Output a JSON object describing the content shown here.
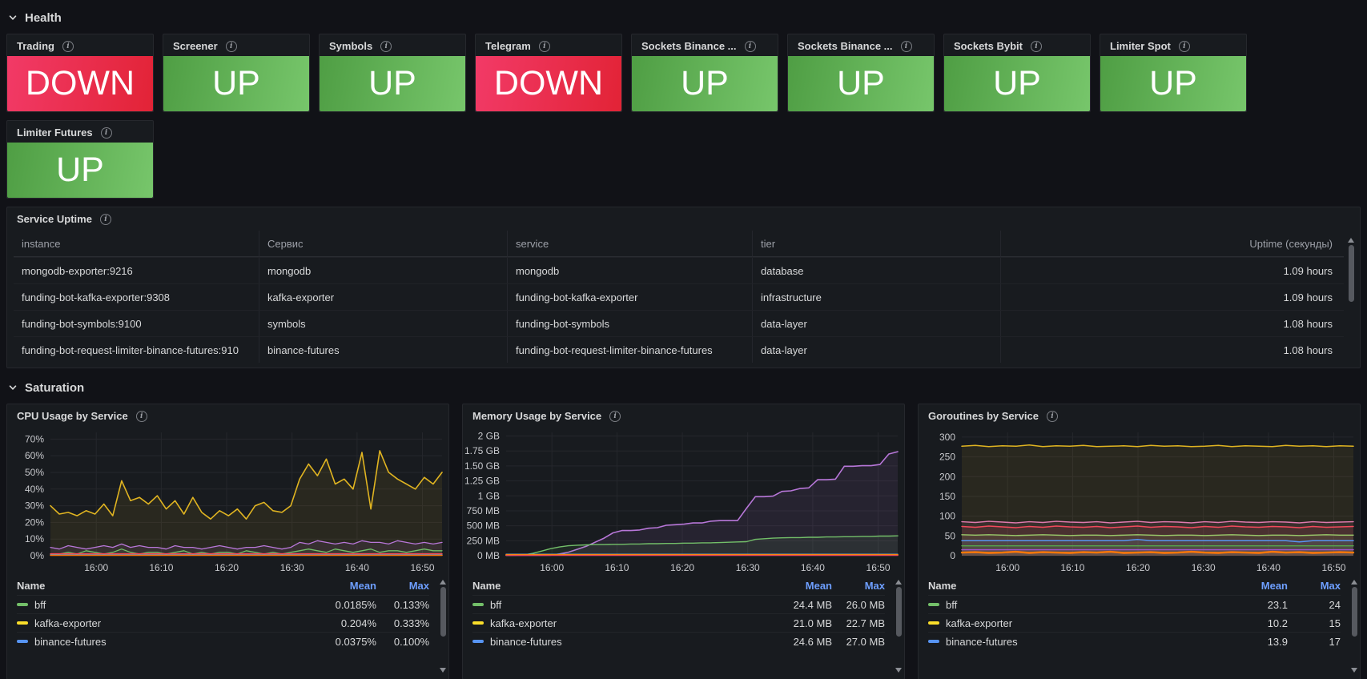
{
  "sections": {
    "health": {
      "label": "Health"
    },
    "saturation": {
      "label": "Saturation"
    }
  },
  "icons": {
    "info": "i"
  },
  "status_colors": {
    "up_gradient": [
      "#4f9e44",
      "#77c66b"
    ],
    "down_gradient": [
      "#f23a67",
      "#e22336"
    ]
  },
  "status_panels": [
    {
      "title": "Trading",
      "state": "DOWN"
    },
    {
      "title": "Screener",
      "state": "UP"
    },
    {
      "title": "Symbols",
      "state": "UP"
    },
    {
      "title": "Telegram",
      "state": "DOWN"
    },
    {
      "title": "Sockets Binance ...",
      "state": "UP"
    },
    {
      "title": "Sockets Binance ...",
      "state": "UP"
    },
    {
      "title": "Sockets Bybit",
      "state": "UP"
    },
    {
      "title": "Limiter Spot",
      "state": "UP"
    },
    {
      "title": "Limiter Futures",
      "state": "UP"
    }
  ],
  "uptime_table": {
    "title": "Service Uptime",
    "columns": [
      "instance",
      "Сервис",
      "service",
      "tier",
      "Uptime (секунды)"
    ],
    "rows": [
      [
        "mongodb-exporter:9216",
        "mongodb",
        "mongodb",
        "database",
        "1.09 hours"
      ],
      [
        "funding-bot-kafka-exporter:9308",
        "kafka-exporter",
        "funding-bot-kafka-exporter",
        "infrastructure",
        "1.09 hours"
      ],
      [
        "funding-bot-symbols:9100",
        "symbols",
        "funding-bot-symbols",
        "data-layer",
        "1.08 hours"
      ],
      [
        "funding-bot-request-limiter-binance-futures:910",
        "binance-futures",
        "funding-bot-request-limiter-binance-futures",
        "data-layer",
        "1.08 hours"
      ]
    ]
  },
  "chart_data": [
    {
      "id": "cpu",
      "type": "area",
      "title": "CPU Usage by Service",
      "xlabel": "",
      "ylabel": "",
      "ylim": [
        0,
        74
      ],
      "yticks": [
        {
          "label": "0%",
          "v": 0
        },
        {
          "label": "10%",
          "v": 10
        },
        {
          "label": "20%",
          "v": 20
        },
        {
          "label": "30%",
          "v": 30
        },
        {
          "label": "40%",
          "v": 40
        },
        {
          "label": "50%",
          "v": 50
        },
        {
          "label": "60%",
          "v": 60
        },
        {
          "label": "70%",
          "v": 70
        }
      ],
      "xticks": [
        {
          "label": "16:00",
          "f": 0.117
        },
        {
          "label": "16:10",
          "f": 0.283
        },
        {
          "label": "16:20",
          "f": 0.45
        },
        {
          "label": "16:30",
          "f": 0.617
        },
        {
          "label": "16:40",
          "f": 0.783
        },
        {
          "label": "16:50",
          "f": 0.95
        }
      ],
      "series": [
        {
          "name": "series-yellow",
          "color": "#e0b421",
          "width": 1.6,
          "values": [
            30,
            25,
            26,
            24,
            27,
            25,
            31,
            24,
            45,
            33,
            35,
            31,
            36,
            28,
            33,
            25,
            35,
            26,
            22,
            27,
            24,
            28,
            22,
            30,
            32,
            27,
            26,
            30,
            46,
            55,
            48,
            58,
            43,
            46,
            40,
            62,
            28,
            63,
            50,
            46,
            43,
            40,
            47,
            43,
            50
          ]
        },
        {
          "name": "series-purple",
          "color": "#b877d9",
          "width": 1.3,
          "values": [
            5,
            4,
            6,
            5,
            4,
            5,
            6,
            5,
            7,
            5,
            6,
            5,
            5,
            4,
            6,
            5,
            5,
            4,
            5,
            6,
            5,
            4,
            5,
            5,
            6,
            5,
            4,
            5,
            8,
            7,
            9,
            8,
            7,
            8,
            7,
            9,
            8,
            8,
            7,
            9,
            8,
            7,
            8,
            7,
            8
          ]
        },
        {
          "name": "series-green",
          "color": "#73bf69",
          "width": 1.3,
          "values": [
            1,
            1,
            2,
            1,
            3,
            2,
            1,
            2,
            4,
            2,
            1,
            2,
            2,
            1,
            2,
            3,
            1,
            2,
            1,
            2,
            2,
            1,
            3,
            2,
            1,
            2,
            1,
            2,
            3,
            4,
            3,
            2,
            4,
            3,
            2,
            3,
            4,
            2,
            3,
            3,
            2,
            3,
            4,
            3,
            3
          ]
        },
        {
          "name": "series-red",
          "color": "#f2495c",
          "width": 1.3,
          "values": [
            1.2,
            1.2
          ]
        },
        {
          "name": "series-blue",
          "color": "#5794f2",
          "width": 1.3,
          "values": [
            0.6,
            0.6
          ]
        },
        {
          "name": "series-orange",
          "color": "#ff780a",
          "width": 1.6,
          "values": [
            0.3,
            0.3
          ]
        }
      ],
      "legend": {
        "columns": [
          "Name",
          "Mean",
          "Max"
        ],
        "rows": [
          {
            "name": "bff",
            "color": "#73bf69",
            "mean": "0.0185%",
            "max": "0.133%"
          },
          {
            "name": "kafka-exporter",
            "color": "#fade2a",
            "mean": "0.204%",
            "max": "0.333%"
          },
          {
            "name": "binance-futures",
            "color": "#5794f2",
            "mean": "0.0375%",
            "max": "0.100%"
          }
        ]
      }
    },
    {
      "id": "memory",
      "type": "area",
      "title": "Memory Usage by Service",
      "xlabel": "",
      "ylabel": "",
      "ylim": [
        0,
        2110
      ],
      "yticks": [
        {
          "label": "0 MB",
          "v": 0
        },
        {
          "label": "250 MB",
          "v": 256
        },
        {
          "label": "500 MB",
          "v": 512
        },
        {
          "label": "750 MB",
          "v": 768
        },
        {
          "label": "1 GB",
          "v": 1024
        },
        {
          "label": "1.25 GB",
          "v": 1280
        },
        {
          "label": "1.50 GB",
          "v": 1536
        },
        {
          "label": "1.75 GB",
          "v": 1792
        },
        {
          "label": "2 GB",
          "v": 2048
        }
      ],
      "xticks": [
        {
          "label": "16:00",
          "f": 0.117
        },
        {
          "label": "16:10",
          "f": 0.283
        },
        {
          "label": "16:20",
          "f": 0.45
        },
        {
          "label": "16:30",
          "f": 0.617
        },
        {
          "label": "16:40",
          "f": 0.783
        },
        {
          "label": "16:50",
          "f": 0.95
        }
      ],
      "series": [
        {
          "name": "series-purple",
          "color": "#b877d9",
          "width": 1.6,
          "values": [
            8,
            8,
            8,
            8,
            8,
            10,
            30,
            60,
            110,
            160,
            230,
            300,
            390,
            430,
            430,
            440,
            470,
            480,
            520,
            530,
            540,
            560,
            560,
            590,
            600,
            600,
            600,
            810,
            1010,
            1010,
            1020,
            1100,
            1110,
            1150,
            1160,
            1300,
            1300,
            1310,
            1530,
            1530,
            1540,
            1540,
            1560,
            1740,
            1780
          ]
        },
        {
          "name": "series-green",
          "color": "#73bf69",
          "width": 1.4,
          "values": [
            5,
            8,
            15,
            40,
            80,
            120,
            150,
            170,
            180,
            185,
            190,
            190,
            195,
            195,
            200,
            200,
            205,
            205,
            210,
            210,
            215,
            215,
            220,
            220,
            225,
            230,
            235,
            240,
            280,
            290,
            300,
            305,
            310,
            310,
            315,
            315,
            320,
            320,
            325,
            325,
            330,
            330,
            335,
            335,
            340
          ]
        },
        {
          "name": "series-blue",
          "color": "#5794f2",
          "width": 1.3,
          "values": [
            25,
            25
          ]
        },
        {
          "name": "series-yellow",
          "color": "#e0b421",
          "width": 1.3,
          "values": [
            21,
            21
          ]
        },
        {
          "name": "series-orange",
          "color": "#ff780a",
          "width": 1.8,
          "values": [
            12,
            12
          ]
        },
        {
          "name": "series-red",
          "color": "#f2495c",
          "width": 1.3,
          "values": [
            6,
            6
          ]
        }
      ],
      "legend": {
        "columns": [
          "Name",
          "Mean",
          "Max"
        ],
        "rows": [
          {
            "name": "bff",
            "color": "#73bf69",
            "mean": "24.4 MB",
            "max": "26.0 MB"
          },
          {
            "name": "kafka-exporter",
            "color": "#fade2a",
            "mean": "21.0 MB",
            "max": "22.7 MB"
          },
          {
            "name": "binance-futures",
            "color": "#5794f2",
            "mean": "24.6 MB",
            "max": "27.0 MB"
          }
        ]
      }
    },
    {
      "id": "goroutines",
      "type": "area",
      "title": "Goroutines by Service",
      "xlabel": "",
      "ylabel": "",
      "ylim": [
        0,
        312
      ],
      "yticks": [
        {
          "label": "0",
          "v": 0
        },
        {
          "label": "50",
          "v": 50
        },
        {
          "label": "100",
          "v": 100
        },
        {
          "label": "150",
          "v": 150
        },
        {
          "label": "200",
          "v": 200
        },
        {
          "label": "250",
          "v": 250
        },
        {
          "label": "300",
          "v": 300
        }
      ],
      "xticks": [
        {
          "label": "16:00",
          "f": 0.117
        },
        {
          "label": "16:10",
          "f": 0.283
        },
        {
          "label": "16:20",
          "f": 0.45
        },
        {
          "label": "16:30",
          "f": 0.617
        },
        {
          "label": "16:40",
          "f": 0.783
        },
        {
          "label": "16:50",
          "f": 0.95
        }
      ],
      "series": [
        {
          "name": "series-yellow",
          "color": "#e0b421",
          "width": 1.5,
          "values": [
            277,
            279,
            276,
            278,
            277,
            280,
            276,
            278,
            277,
            279,
            276,
            277,
            278,
            276,
            279,
            277,
            278,
            276,
            277,
            279,
            276,
            278,
            277,
            276,
            279,
            277,
            278,
            276,
            278,
            277
          ]
        },
        {
          "name": "series-pink",
          "color": "#de7bae",
          "width": 1.4,
          "values": [
            86,
            84,
            87,
            85,
            83,
            86,
            84,
            87,
            85,
            84,
            86,
            83,
            85,
            87,
            84,
            86,
            85,
            83,
            86,
            84,
            87,
            85,
            84,
            86,
            85,
            83,
            86,
            84,
            85,
            86
          ]
        },
        {
          "name": "series-red",
          "color": "#f2495c",
          "width": 1.4,
          "values": [
            74,
            72,
            75,
            73,
            71,
            74,
            72,
            75,
            73,
            72,
            74,
            71,
            73,
            75,
            72,
            74,
            73,
            71,
            74,
            72,
            75,
            73,
            72,
            74,
            73,
            71,
            74,
            72,
            73,
            74
          ]
        },
        {
          "name": "series-green",
          "color": "#9acb6a",
          "width": 1.4,
          "values": [
            53,
            52,
            53,
            52,
            51,
            52,
            53,
            52,
            51,
            52,
            52,
            51,
            52,
            53,
            52,
            51,
            52,
            52,
            51,
            52,
            53,
            52,
            51,
            52,
            52,
            51,
            52,
            53,
            52,
            52
          ]
        },
        {
          "name": "series-blue",
          "color": "#5794f2",
          "width": 1.5,
          "values": [
            38,
            38,
            38,
            38,
            38,
            38,
            38,
            38,
            38,
            38,
            38,
            38,
            38,
            41,
            38,
            38,
            38,
            38,
            38,
            38,
            38,
            38,
            38,
            38,
            38,
            35,
            38,
            38,
            38,
            38
          ]
        },
        {
          "name": "series-green-dark",
          "color": "#56a64b",
          "width": 1.4,
          "values": [
            25,
            25
          ]
        },
        {
          "name": "series-purple",
          "color": "#a352cc",
          "width": 1.4,
          "values": [
            15,
            15
          ]
        },
        {
          "name": "series-orange",
          "color": "#ff780a",
          "width": 2.4,
          "values": [
            8,
            9,
            7,
            8,
            10,
            7,
            9,
            8,
            7,
            9,
            8,
            10,
            7,
            8,
            9,
            7,
            8,
            10,
            8,
            7,
            9,
            8,
            7,
            10,
            8,
            9,
            7,
            8,
            9,
            8
          ]
        }
      ],
      "legend": {
        "columns": [
          "Name",
          "Mean",
          "Max"
        ],
        "rows": [
          {
            "name": "bff",
            "color": "#73bf69",
            "mean": "23.1",
            "max": "24"
          },
          {
            "name": "kafka-exporter",
            "color": "#fade2a",
            "mean": "10.2",
            "max": "15"
          },
          {
            "name": "binance-futures",
            "color": "#5794f2",
            "mean": "13.9",
            "max": "17"
          }
        ]
      }
    }
  ]
}
